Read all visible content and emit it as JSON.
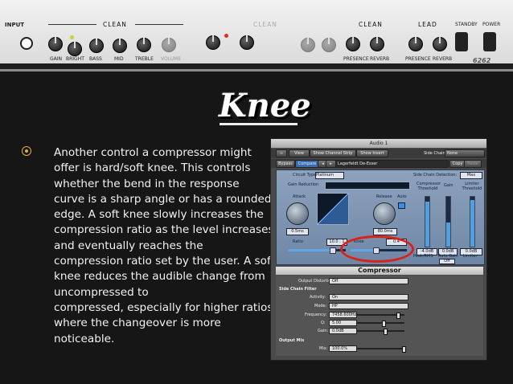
{
  "amp_header": {
    "input_label": "INPUT",
    "sections": [
      "CLEAN",
      "CLEAN",
      "CLEAN",
      "LEAD"
    ],
    "standby_label": "STANDBY",
    "power_label": "POWER",
    "knob_labels": [
      "GAIN",
      "BRIGHT",
      "BASS",
      "MID",
      "TREBLE",
      "VOLUME",
      "PRESENCE",
      "REVERB",
      "PRESENCE",
      "REVERB"
    ],
    "model_badge": "6262"
  },
  "slide": {
    "title": "Knee",
    "bullet_lines": [
      "Another control a compressor might",
      "offer is hard/soft knee. This controls",
      "whether the bend in the response",
      "curve is a sharp angle or has a rounded",
      "edge. A soft knee slowly increases the",
      "compression ratio as the level increases",
      "and eventually reaches the",
      "compression ratio set by the user. A soft",
      "knee reduces the audible change from",
      "uncompressed to",
      "compressed, especially for higher ratios",
      "where the changeover is more",
      "noticeable."
    ]
  },
  "plugin": {
    "window_title": "Audio 1",
    "view_menu": "View",
    "channel_strip_menu": "Show Channel Strip",
    "insert_menu": "Show Insert",
    "side_chain_label": "Side Chain:",
    "side_chain_value": "None",
    "bypass_label": "Bypass",
    "compare_label": "Compare",
    "preset_name": "Lagerfeldt De-Esser",
    "copy_label": "Copy",
    "paste_label": "Paste",
    "circuit_type_label": "Circuit Type:",
    "circuit_type_value": "Platinum",
    "side_chain_detection_label": "Side Chain Detection:",
    "side_chain_detection_value": "Max",
    "gain_reduction_label": "Gain Reduction",
    "attack_label": "Attack",
    "attack_value": "0.5ms",
    "release_label": "Release",
    "release_value": "80.0ms",
    "auto_label": "Auto",
    "ratio_label": "Ratio",
    "ratio_value": "10.0 : 1",
    "knee_label": "Knee",
    "knee_value": "0.4",
    "compressor_threshold_label": "Compressor Threshold",
    "compressor_threshold_value": "-4.0dB",
    "gain_label": "Gain",
    "gain_value": "0.0dB",
    "limiter_threshold_label": "Limiter Threshold",
    "limiter_threshold_value": "0.0dB",
    "peak_rms_label": "Peak/RMS",
    "auto_gain_label": "Auto Gain",
    "auto_gain_value": "Off",
    "limiter_label": "Limiter",
    "compressor_title": "Compressor",
    "output_distortion_label": "Output Distortion:",
    "output_distortion_value": "Off",
    "side_chain_filter_label": "Side Chain Filter",
    "activity_label": "Activity:",
    "activity_value": "On",
    "mode_label": "Mode:",
    "mode_value": "HP",
    "frequency_label": "Frequency:",
    "frequency_value": "7458.600Hz",
    "q_label": "Q:",
    "q_value": "5.00",
    "sc_gain_label": "Gain:",
    "sc_gain_value": "0.0dB",
    "output_mix_label": "Output Mix",
    "mix_label": "Mix:",
    "mix_value": "100.0%"
  },
  "colors": {
    "background": "#161616",
    "bullet": "#e0b23a",
    "highlight_ring": "#d8221c",
    "plugin_panel": "#7f96b3"
  }
}
